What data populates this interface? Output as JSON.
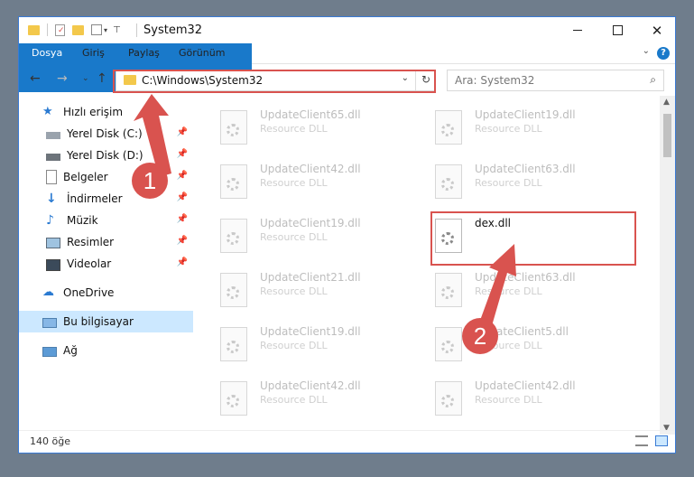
{
  "window": {
    "title": "System32"
  },
  "ribbon": {
    "tabs": [
      "Dosya",
      "Giriş",
      "Paylaş",
      "Görünüm"
    ],
    "help": "?"
  },
  "address": {
    "path": "C:\\Windows\\System32"
  },
  "search": {
    "placeholder": "Ara: System32"
  },
  "sidebar": {
    "items": [
      {
        "label": "Hızlı erişim",
        "icon": "star-icon"
      },
      {
        "label": "Yerel Disk (C:)",
        "icon": "drive-icon"
      },
      {
        "label": "Yerel Disk (D:)",
        "icon": "drive-icon"
      },
      {
        "label": "Belgeler",
        "icon": "documents-icon"
      },
      {
        "label": "İndirmeler",
        "icon": "downloads-icon"
      },
      {
        "label": "Müzik",
        "icon": "music-icon"
      },
      {
        "label": "Resimler",
        "icon": "pictures-icon"
      },
      {
        "label": "Videolar",
        "icon": "videos-icon"
      },
      {
        "label": "OneDrive",
        "icon": "cloud-icon"
      },
      {
        "label": "Bu bilgisayar",
        "icon": "computer-icon"
      },
      {
        "label": "Ağ",
        "icon": "network-icon"
      }
    ]
  },
  "files": [
    {
      "name": "UpdateClient65.dll",
      "type": "Resource DLL"
    },
    {
      "name": "UpdateClient19.dll",
      "type": "Resource DLL"
    },
    {
      "name": "UpdateClient42.dll",
      "type": "Resource DLL"
    },
    {
      "name": "UpdateClient63.dll",
      "type": "Resource DLL"
    },
    {
      "name": "UpdateClient19.dll",
      "type": "Resource DLL"
    },
    {
      "name": "dex.dll",
      "type": ""
    },
    {
      "name": "UpdateClient21.dll",
      "type": "Resource DLL"
    },
    {
      "name": "UpdateClient63.dll",
      "type": "Resource DLL"
    },
    {
      "name": "UpdateClient19.dll",
      "type": "Resource DLL"
    },
    {
      "name": "UpdateClient5.dll",
      "type": "Resource DLL"
    },
    {
      "name": "UpdateClient42.dll",
      "type": "Resource DLL"
    },
    {
      "name": "UpdateClient42.dll",
      "type": "Resource DLL"
    }
  ],
  "status": {
    "count": "140 öğe"
  },
  "annotations": {
    "badge1": "1",
    "badge2": "2"
  },
  "colors": {
    "accent": "#1979ca",
    "highlight": "#d9534f",
    "selected": "#cce8ff"
  }
}
